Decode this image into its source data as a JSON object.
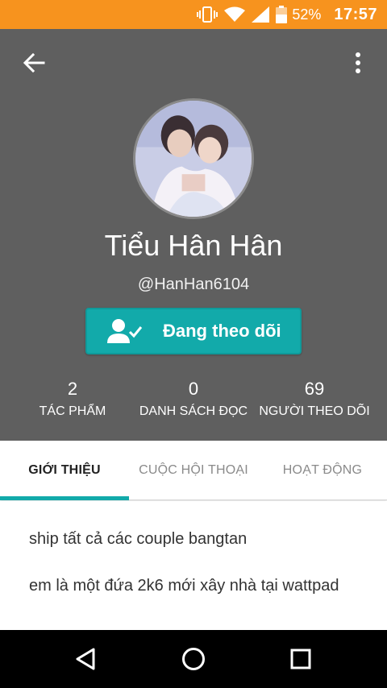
{
  "status_bar": {
    "battery_percent": "52%",
    "time": "17:57",
    "icons": [
      "vibrate-icon",
      "wifi-icon",
      "signal-icon",
      "battery-icon"
    ],
    "color": "#f7931e"
  },
  "toolbar": {
    "back_icon": "arrow-left-icon",
    "menu_icon": "more-vertical-icon"
  },
  "profile": {
    "name": "Tiểu Hân Hân",
    "username": "@HanHan6104",
    "follow_button_label": "Đang theo dõi",
    "follow_button_icon": "user-check-icon",
    "accent": "#12aaaa",
    "header_color": "#5f5f5f"
  },
  "stats": [
    {
      "value": "2",
      "label": "TÁC PHẨM"
    },
    {
      "value": "0",
      "label": "DANH SÁCH ĐỌC"
    },
    {
      "value": "69",
      "label": "NGƯỜI THEO DÕI"
    }
  ],
  "tabs": [
    {
      "label": "GIỚI THIỆU",
      "active": true
    },
    {
      "label": "CUỘC HỘI THOẠI",
      "active": false
    },
    {
      "label": "HOẠT ĐỘNG",
      "active": false
    }
  ],
  "about": {
    "lines": [
      "ship tất cả các couple bangtan",
      "em là một đứa 2k6 mới xây nhà tại wattpad"
    ]
  },
  "nav_bar": {
    "icons": [
      "back-triangle-icon",
      "home-circle-icon",
      "recents-square-icon"
    ]
  }
}
